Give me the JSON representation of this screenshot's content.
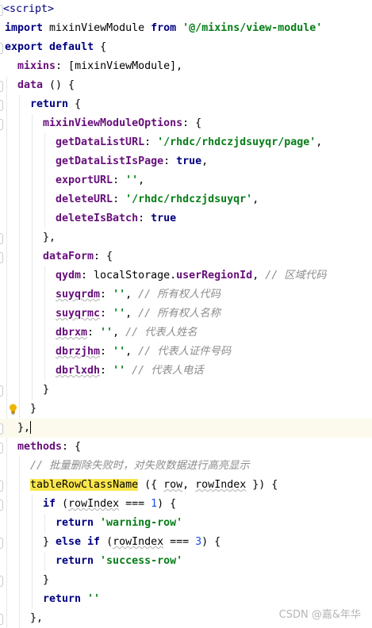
{
  "editor": {
    "language": "vue/javascript",
    "lines": [
      {
        "tokens": [
          [
            "tag",
            "<script>"
          ]
        ]
      },
      {
        "tokens": [
          [
            "kw",
            "import "
          ],
          [
            "plain",
            "mixinViewModule "
          ],
          [
            "kw",
            "from "
          ],
          [
            "str",
            "'@/mixins/view-module'"
          ]
        ]
      },
      {
        "tokens": [
          [
            "kw",
            "export default "
          ],
          [
            "plain",
            "{"
          ]
        ]
      },
      {
        "tokens": [
          [
            "prop",
            "mixins"
          ],
          [
            "plain",
            ": [mixinViewModule],"
          ]
        ]
      },
      {
        "tokens": [
          [
            "prop",
            "data "
          ],
          [
            "plain",
            "() {"
          ]
        ]
      },
      {
        "tokens": [
          [
            "kw",
            "return "
          ],
          [
            "plain",
            "{"
          ]
        ]
      },
      {
        "tokens": [
          [
            "prop",
            "mixinViewModuleOptions"
          ],
          [
            "plain",
            ": {"
          ]
        ]
      },
      {
        "tokens": [
          [
            "prop",
            "getDataListURL"
          ],
          [
            "plain",
            ": "
          ],
          [
            "str",
            "'/rhdc/rhdczjdsuyqr/page'"
          ],
          [
            "plain",
            ","
          ]
        ]
      },
      {
        "tokens": [
          [
            "prop",
            "getDataListIsPage"
          ],
          [
            "plain",
            ": "
          ],
          [
            "kw",
            "true"
          ],
          [
            "plain",
            ","
          ]
        ]
      },
      {
        "tokens": [
          [
            "prop",
            "exportURL"
          ],
          [
            "plain",
            ": "
          ],
          [
            "str",
            "''"
          ],
          [
            "plain",
            ","
          ]
        ]
      },
      {
        "tokens": [
          [
            "prop",
            "deleteURL"
          ],
          [
            "plain",
            ": "
          ],
          [
            "str",
            "'/rhdc/rhdczjdsuyqr'"
          ],
          [
            "plain",
            ","
          ]
        ]
      },
      {
        "tokens": [
          [
            "prop",
            "deleteIsBatch"
          ],
          [
            "plain",
            ": "
          ],
          [
            "kw",
            "true"
          ]
        ]
      },
      {
        "tokens": [
          [
            "plain",
            "},"
          ]
        ]
      },
      {
        "tokens": [
          [
            "prop",
            "dataForm"
          ],
          [
            "plain",
            ": {"
          ]
        ]
      },
      {
        "tokens": [
          [
            "prop",
            "qydm"
          ],
          [
            "plain",
            ": localStorage."
          ],
          [
            "prop",
            "userRegionId"
          ],
          [
            "plain",
            ", "
          ],
          [
            "cmt",
            "// 区域代码"
          ]
        ]
      },
      {
        "tokens": [
          [
            "prop",
            "suyqrdm"
          ],
          [
            "plain",
            ": "
          ],
          [
            "str",
            "''"
          ],
          [
            "plain",
            ", "
          ],
          [
            "cmt",
            "// 所有权人代码"
          ]
        ]
      },
      {
        "tokens": [
          [
            "prop",
            "suyqrmc"
          ],
          [
            "plain",
            ": "
          ],
          [
            "str",
            "''"
          ],
          [
            "plain",
            ", "
          ],
          [
            "cmt",
            "// 所有权人名称"
          ]
        ]
      },
      {
        "tokens": [
          [
            "prop",
            "dbrxm"
          ],
          [
            "plain",
            ": "
          ],
          [
            "str",
            "''"
          ],
          [
            "plain",
            ", "
          ],
          [
            "cmt",
            "// 代表人姓名"
          ]
        ]
      },
      {
        "tokens": [
          [
            "prop",
            "dbrzjhm"
          ],
          [
            "plain",
            ": "
          ],
          [
            "str",
            "''"
          ],
          [
            "plain",
            ", "
          ],
          [
            "cmt",
            "// 代表人证件号码"
          ]
        ]
      },
      {
        "tokens": [
          [
            "prop",
            "dbrlxdh"
          ],
          [
            "plain",
            ": "
          ],
          [
            "str",
            "''"
          ],
          [
            "plain",
            " "
          ],
          [
            "cmt",
            "// 代表人电话"
          ]
        ]
      },
      {
        "tokens": [
          [
            "plain",
            "}"
          ]
        ]
      },
      {
        "tokens": [
          [
            "plain",
            "}"
          ]
        ]
      },
      {
        "tokens": [
          [
            "plain",
            "},"
          ]
        ]
      },
      {
        "tokens": [
          [
            "prop",
            "methods"
          ],
          [
            "plain",
            ": {"
          ]
        ]
      },
      {
        "tokens": [
          [
            "cmt",
            "// 批量删除失败时，对失败数据进行高亮显示"
          ]
        ]
      },
      {
        "tokens": [
          [
            "hl",
            "tableRowClassName"
          ],
          [
            "plain",
            " ({ "
          ],
          [
            "plain",
            "row"
          ],
          [
            "plain",
            ", "
          ],
          [
            "plain",
            "rowIndex"
          ],
          [
            "plain",
            " }) {"
          ]
        ]
      },
      {
        "tokens": [
          [
            "kw",
            "if "
          ],
          [
            "plain",
            "("
          ],
          [
            "plain",
            "rowIndex"
          ],
          [
            "plain",
            " === "
          ],
          [
            "num",
            "1"
          ],
          [
            "plain",
            ") {"
          ]
        ]
      },
      {
        "tokens": [
          [
            "kw",
            "return "
          ],
          [
            "str",
            "'warning-row'"
          ]
        ]
      },
      {
        "tokens": [
          [
            "plain",
            "} "
          ],
          [
            "kw",
            "else if "
          ],
          [
            "plain",
            "("
          ],
          [
            "plain",
            "rowIndex"
          ],
          [
            "plain",
            " === "
          ],
          [
            "num",
            "3"
          ],
          [
            "plain",
            ") {"
          ]
        ]
      },
      {
        "tokens": [
          [
            "kw",
            "return "
          ],
          [
            "str",
            "'success-row'"
          ]
        ]
      },
      {
        "tokens": [
          [
            "plain",
            "}"
          ]
        ]
      },
      {
        "tokens": [
          [
            "kw",
            "return "
          ],
          [
            "str",
            "''"
          ]
        ]
      },
      {
        "tokens": [
          [
            "plain",
            "},"
          ]
        ]
      }
    ]
  },
  "watermark": "CSDN @嘉&年华"
}
